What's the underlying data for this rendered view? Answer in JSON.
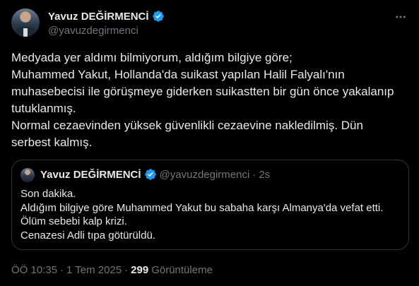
{
  "author": {
    "name": "Yavuz DEĞİRMENCİ",
    "handle": "@yavuzdegirmenci"
  },
  "tweet": {
    "lines": [
      "Medyada yer aldımı bilmiyorum, aldığım bilgiye göre;",
      "Muhammed Yakut, Hollanda'da suikast yapılan Halil Falyalı'nın",
      "muhasebecisi ile görüşmeye giderken suikastten bir gün önce yakalanıp",
      "tutuklanmış.",
      "Normal cezaevinden yüksek güvenlikli cezaevine nakledilmiş. Dün",
      "serbest kalmış."
    ]
  },
  "quote": {
    "name": "Yavuz DEĞİRMENCİ",
    "handle": "@yavuzdegirmenci",
    "separator": "·",
    "time": "2s",
    "lines": [
      "Son dakika.",
      "Aldığım bilgiye göre Muhammed Yakut bu sabaha karşı Almanya'da vefat etti.",
      "Ölüm sebebi kalp krizi.",
      "Cenazesi Adli tıpa götürüldü."
    ]
  },
  "meta": {
    "time": "ÖÖ 10:35",
    "separator": "·",
    "date": "1 Tem 2025",
    "separator2": "·",
    "views_count": "299",
    "views_label": "Görüntüleme"
  },
  "colors": {
    "background": "#000000",
    "text": "#e7e9ea",
    "secondary": "#71767b",
    "verified": "#1d9bf0",
    "border": "#2f3336"
  },
  "icons": {
    "verified": "verified-badge-icon",
    "more": "more-horizontal-icon"
  }
}
